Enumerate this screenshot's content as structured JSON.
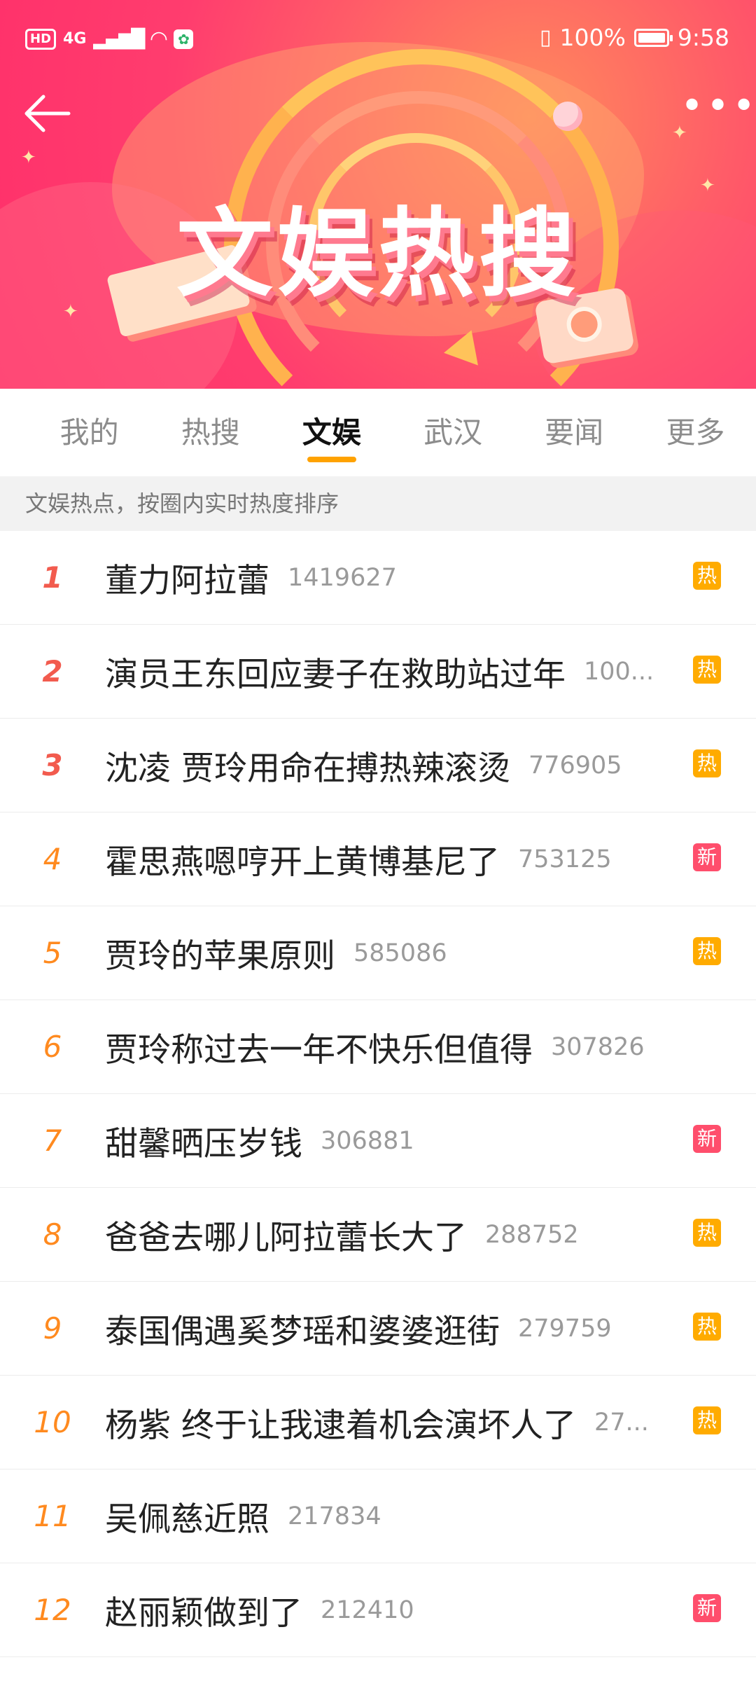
{
  "status_bar": {
    "hd": "HD",
    "network": "4G",
    "battery_percent": "100%",
    "time": "9:58"
  },
  "banner": {
    "title": "文娱热搜"
  },
  "tabs": [
    {
      "label": "我的",
      "active": false
    },
    {
      "label": "热搜",
      "active": false
    },
    {
      "label": "文娱",
      "active": true
    },
    {
      "label": "武汉",
      "active": false
    },
    {
      "label": "要闻",
      "active": false
    },
    {
      "label": "更多",
      "active": false
    }
  ],
  "subtitle": "文娱热点，按圈内实时热度排序",
  "list": [
    {
      "rank": "1",
      "title": "董力阿拉蕾",
      "count": "1419627",
      "badge": "热",
      "badge_type": "hot"
    },
    {
      "rank": "2",
      "title": "演员王东回应妻子在救助站过年",
      "count": "100...",
      "badge": "热",
      "badge_type": "hot"
    },
    {
      "rank": "3",
      "title": "沈凌 贾玲用命在搏热辣滚烫",
      "count": "776905",
      "badge": "热",
      "badge_type": "hot"
    },
    {
      "rank": "4",
      "title": "霍思燕嗯哼开上黄博基尼了",
      "count": "753125",
      "badge": "新",
      "badge_type": "new"
    },
    {
      "rank": "5",
      "title": "贾玲的苹果原则",
      "count": "585086",
      "badge": "热",
      "badge_type": "hot"
    },
    {
      "rank": "6",
      "title": "贾玲称过去一年不快乐但值得",
      "count": "307826",
      "badge": "",
      "badge_type": "none"
    },
    {
      "rank": "7",
      "title": "甜馨晒压岁钱",
      "count": "306881",
      "badge": "新",
      "badge_type": "new"
    },
    {
      "rank": "8",
      "title": "爸爸去哪儿阿拉蕾长大了",
      "count": "288752",
      "badge": "热",
      "badge_type": "hot"
    },
    {
      "rank": "9",
      "title": "泰国偶遇奚梦瑶和婆婆逛街",
      "count": "279759",
      "badge": "热",
      "badge_type": "hot"
    },
    {
      "rank": "10",
      "title": "杨紫 终于让我逮着机会演坏人了",
      "count": "27...",
      "badge": "热",
      "badge_type": "hot"
    },
    {
      "rank": "11",
      "title": "吴佩慈近照",
      "count": "217834",
      "badge": "",
      "badge_type": "none"
    },
    {
      "rank": "12",
      "title": "赵丽颖做到了",
      "count": "212410",
      "badge": "新",
      "badge_type": "new"
    }
  ],
  "colors": {
    "tab_indicator": "#ffa200",
    "rank_top": "#f25b4e",
    "rank_other": "#ff8a1f",
    "badge_hot": "#ffab00",
    "badge_new": "#ff4e6c"
  }
}
